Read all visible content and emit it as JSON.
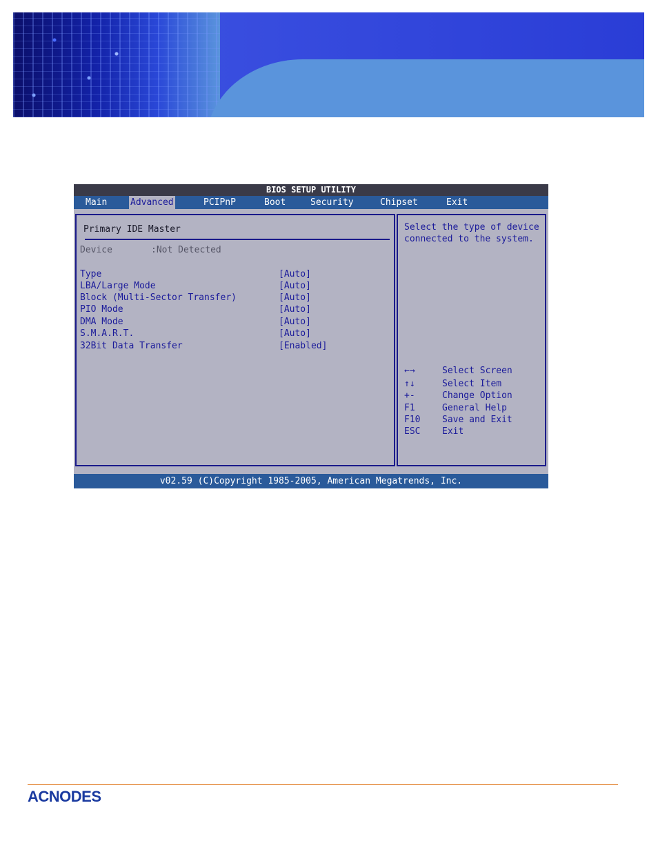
{
  "bios": {
    "title": "BIOS SETUP UTILITY",
    "menu": [
      "Main",
      "Advanced",
      "PCIPnP",
      "Boot",
      "Security",
      "Chipset",
      "Exit"
    ],
    "active_menu": "Advanced",
    "section_title": "Primary IDE Master",
    "device": {
      "label": "Device",
      "value": ":Not Detected"
    },
    "settings": [
      {
        "label": "Type",
        "value": "[Auto]"
      },
      {
        "label": "LBA/Large Mode",
        "value": "[Auto]"
      },
      {
        "label": "Block (Multi-Sector Transfer)",
        "value": "[Auto]"
      },
      {
        "label": "PIO Mode",
        "value": "[Auto]"
      },
      {
        "label": "DMA Mode",
        "value": "[Auto]"
      },
      {
        "label": "S.M.A.R.T.",
        "value": "[Auto]"
      },
      {
        "label": "32Bit Data Transfer",
        "value": "[Enabled]"
      }
    ],
    "help": "Select the type of device connected to the system.",
    "keys": [
      {
        "key": "←→",
        "desc": "Select Screen"
      },
      {
        "key": "↑↓",
        "desc": "Select Item"
      },
      {
        "key": "+-",
        "desc": "Change Option"
      },
      {
        "key": "F1",
        "desc": "General Help"
      },
      {
        "key": "F10",
        "desc": "Save and Exit"
      },
      {
        "key": "ESC",
        "desc": "Exit"
      }
    ],
    "footer": "v02.59 (C)Copyright 1985-2005, American Megatrends, Inc."
  },
  "logo": {
    "text": "ACNODES"
  },
  "colors": {
    "bios_bg": "#b3b3c3",
    "bar_blue": "#2a5a9a",
    "text_blue": "#1a1a9a",
    "accent_orange": "#e07820"
  }
}
